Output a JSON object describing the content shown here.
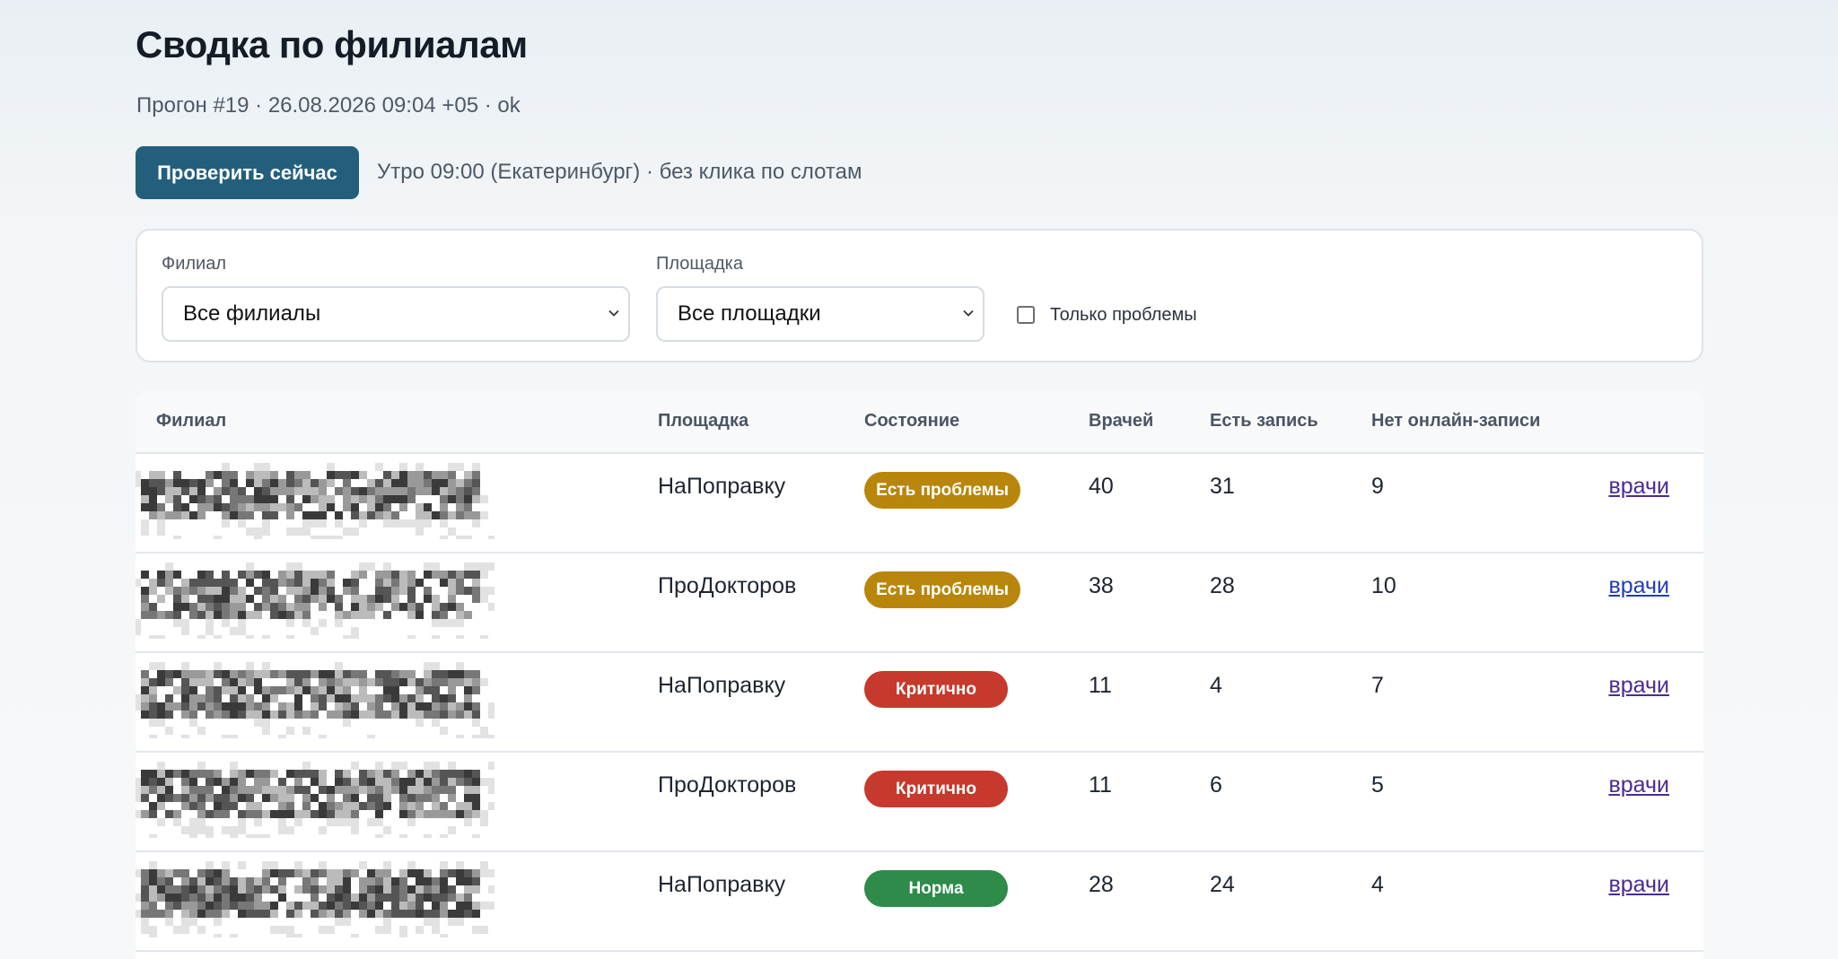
{
  "page": {
    "title": "Сводка по филиалам",
    "run_info": "Прогон #19 · 26.08.2026 09:04 +05 · ok"
  },
  "actions": {
    "check_now_label": "Проверить сейчас",
    "schedule_note": "Утро 09:00 (Екатеринбург) · без клика по слотам"
  },
  "filters": {
    "branch_label": "Филиал",
    "branch_value": "Все филиалы",
    "platform_label": "Площадка",
    "platform_value": "Все площадки",
    "only_problems_label": "Только проблемы",
    "only_problems_checked": false
  },
  "table": {
    "headers": {
      "branch": "Филиал",
      "platform": "Площадка",
      "status": "Состояние",
      "doctors": "Врачей",
      "has_booking": "Есть запись",
      "no_online": "Нет онлайн-записи"
    },
    "status_colors": {
      "problems": "#b8860b",
      "critical": "#c53a2c",
      "normal": "#2e8b4a"
    },
    "rows": [
      {
        "platform": "НаПоправку",
        "status": "Есть проблемы",
        "status_kind": "problems",
        "doctors": "40",
        "has_booking": "31",
        "no_online": "9",
        "link": "врачи"
      },
      {
        "platform": "ПроДокторов",
        "status": "Есть проблемы",
        "status_kind": "problems",
        "doctors": "38",
        "has_booking": "28",
        "no_online": "10",
        "link": "врачи"
      },
      {
        "platform": "НаПоправку",
        "status": "Критично",
        "status_kind": "critical",
        "doctors": "11",
        "has_booking": "4",
        "no_online": "7",
        "link": "врачи"
      },
      {
        "platform": "ПроДокторов",
        "status": "Критично",
        "status_kind": "critical",
        "doctors": "11",
        "has_booking": "6",
        "no_online": "5",
        "link": "врачи"
      },
      {
        "platform": "НаПоправку",
        "status": "Норма",
        "status_kind": "normal",
        "doctors": "28",
        "has_booking": "24",
        "no_online": "4",
        "link": "врачи"
      }
    ]
  }
}
